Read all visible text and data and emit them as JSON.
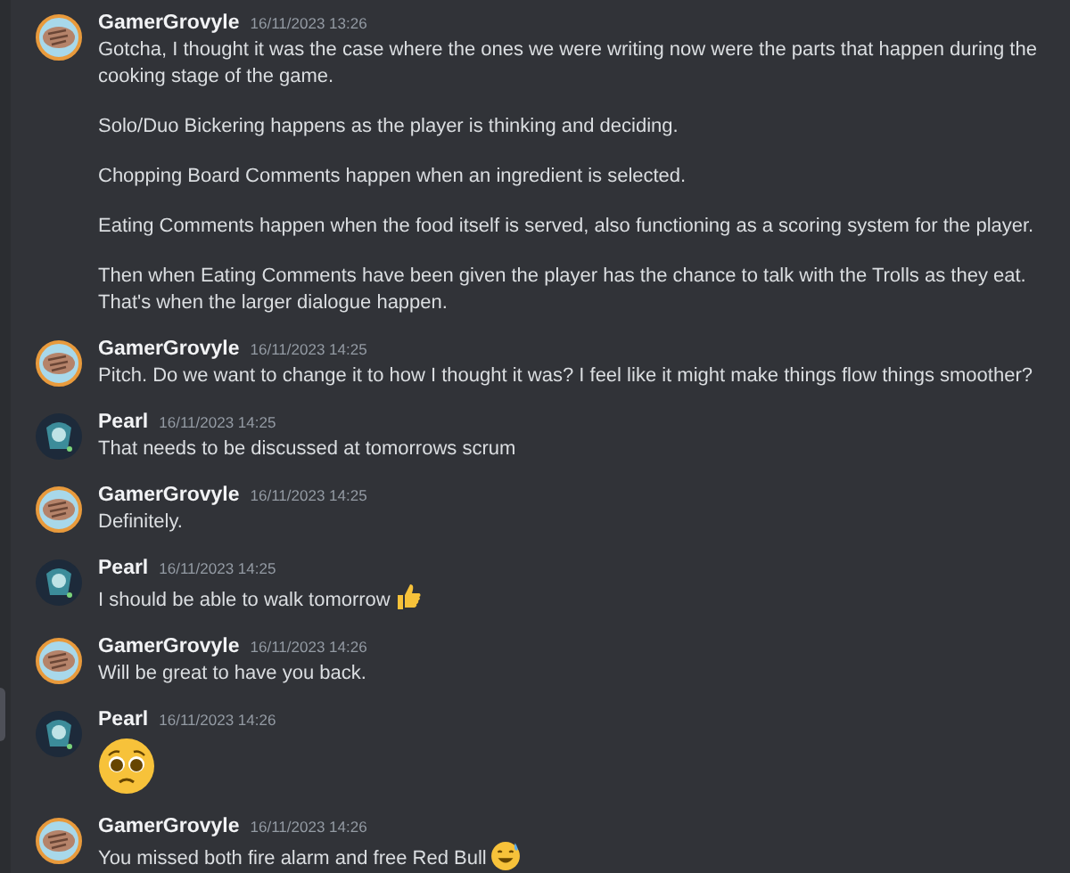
{
  "messages": [
    {
      "author": "GamerGrovyle",
      "avatar": {
        "kind": "ring"
      },
      "time": "16/11/2023 13:26",
      "paragraphs": [
        "Gotcha, I thought it was the case where the ones we were writing now were the parts that happen during the cooking stage of the game.",
        "Solo/Duo Bickering happens as the player is thinking and deciding.",
        "Chopping Board Comments happen when an ingredient is selected.",
        "Eating Comments happen when the food itself is served, also functioning as a scoring system for the player.",
        "Then when Eating Comments have been given the player has the chance to talk with the Trolls as they eat. That's when the larger dialogue happen."
      ]
    },
    {
      "author": "GamerGrovyle",
      "avatar": {
        "kind": "ring"
      },
      "time": "16/11/2023 14:25",
      "paragraphs": [
        "Pitch. Do we want to change it to how I thought it was? I feel like it might make things flow things smoother?"
      ]
    },
    {
      "author": "Pearl",
      "avatar": {
        "kind": "dark"
      },
      "time": "16/11/2023 14:25",
      "paragraphs": [
        "That needs to be discussed at tomorrows scrum"
      ]
    },
    {
      "author": "GamerGrovyle",
      "avatar": {
        "kind": "ring"
      },
      "time": "16/11/2023 14:25",
      "paragraphs": [
        "Definitely."
      ]
    },
    {
      "author": "Pearl",
      "avatar": {
        "kind": "dark"
      },
      "time": "16/11/2023 14:25",
      "paragraphs": [
        "I should be able to walk tomorrow"
      ],
      "emoji": {
        "kind": "thumbs"
      }
    },
    {
      "author": "GamerGrovyle",
      "avatar": {
        "kind": "ring"
      },
      "time": "16/11/2023 14:26",
      "paragraphs": [
        "Will be great to have you back."
      ]
    },
    {
      "author": "Pearl",
      "avatar": {
        "kind": "dark"
      },
      "time": "16/11/2023 14:26",
      "emoji": {
        "kind": "pleading_big"
      }
    },
    {
      "author": "GamerGrovyle",
      "avatar": {
        "kind": "ring"
      },
      "time": "16/11/2023 14:26",
      "paragraphs": [
        "You missed both fire alarm and free Red Bull"
      ],
      "emoji": {
        "kind": "sweat"
      }
    }
  ]
}
